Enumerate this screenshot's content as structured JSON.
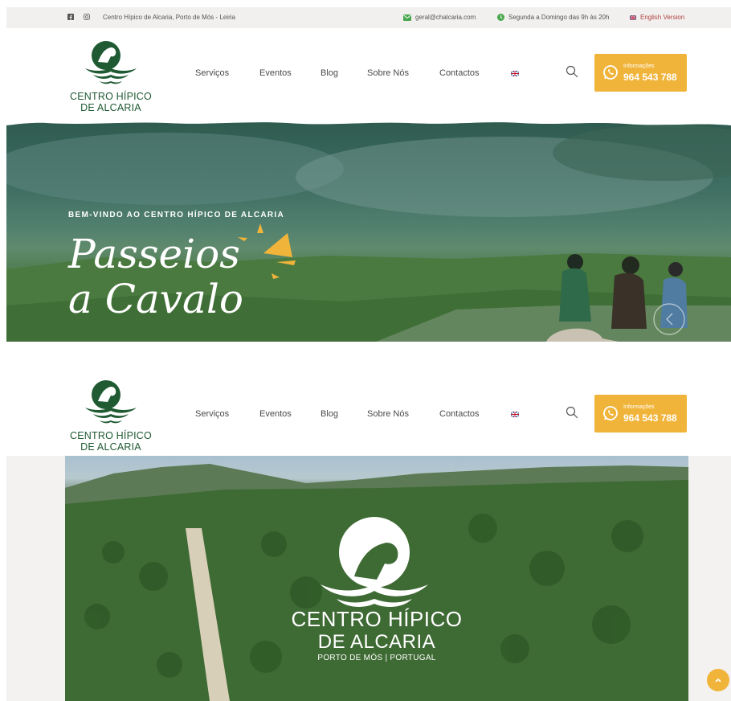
{
  "topbar": {
    "address": "Centro Hípico de Alcaria, Porto de Mós - Leiria",
    "email": "geral@chalcaria.com",
    "hours": "Segunda a Domingo das 9h às 20h",
    "language": "English Version",
    "icons": [
      "facebook-icon",
      "instagram-icon",
      "email-icon",
      "clock-icon",
      "uk-flag-icon"
    ]
  },
  "header": {
    "logo_line1": "CENTRO HÍPICO",
    "logo_line2": "DE ALCARIA",
    "nav": [
      "Serviços",
      "Eventos",
      "Blog",
      "Sobre Nós",
      "Contactos"
    ],
    "cta_label": "Informações",
    "cta_phone": "964 543 788"
  },
  "hero1": {
    "tagline": "BEM-VINDO AO CENTRO HÍPICO DE ALCARIA",
    "title_line1": "Passeios",
    "title_line2": "a Cavalo"
  },
  "hero2": {
    "brand_line1": "CENTRO HÍPICO",
    "brand_line2": "DE ALCARIA",
    "brand_sub": "PORTO DE MÓS  |  PORTUGAL"
  },
  "colors": {
    "brand_green": "#1f5a32",
    "accent": "#f1b43a",
    "topbar_bg": "#f1f0ee"
  }
}
